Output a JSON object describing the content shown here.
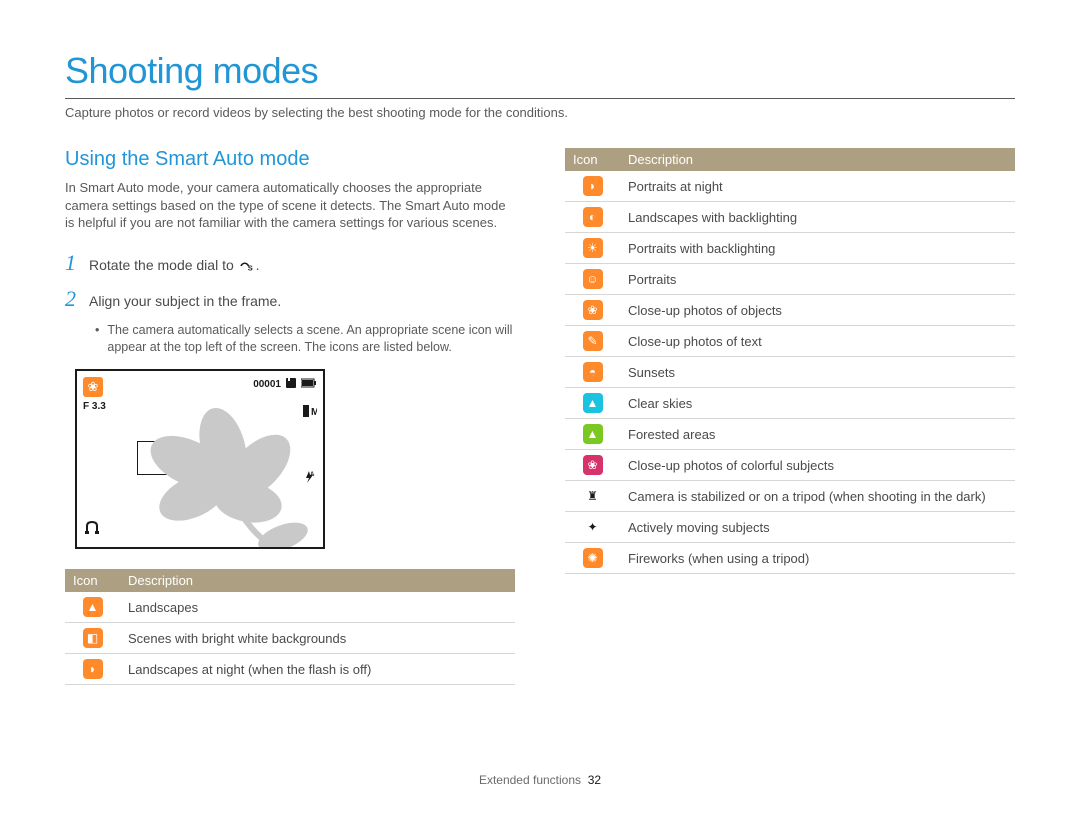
{
  "title": "Shooting modes",
  "subtitle": "Capture photos or record videos by selecting the best shooting mode for the conditions.",
  "section_heading": "Using the Smart Auto mode",
  "section_body": "In Smart Auto mode, your camera automatically chooses the appropriate camera settings based on the type of scene it detects. The Smart Auto mode is helpful if you are not familiar with the camera settings for various scenes.",
  "steps": {
    "s1_num": "1",
    "s1_text": "Rotate the mode dial to ",
    "s1_icon_label": "smart-auto-glyph",
    "s1_tail": ".",
    "s2_num": "2",
    "s2_text": "Align your subject in the frame.",
    "s2_sub": "The camera automatically selects a scene. An appropriate scene icon will appear at the top left of the screen. The icons are listed below."
  },
  "screen": {
    "fnum": "F 3.3",
    "counter": "00001",
    "mem_icon": "memory-card-icon",
    "batt_icon": "battery-icon",
    "quality": "M",
    "flash": "flash-auto-icon",
    "ois": "ois-icon",
    "topleft_icon": "macro-flower-icon"
  },
  "table_headers": {
    "icon": "Icon",
    "desc": "Description"
  },
  "left_table": [
    {
      "icon": "landscape-icon",
      "color": "orange",
      "glyph": "▲",
      "desc": "Landscapes"
    },
    {
      "icon": "white-bg-icon",
      "color": "orange",
      "glyph": "◧",
      "desc": "Scenes with bright white backgrounds"
    },
    {
      "icon": "night-landscape-icon",
      "color": "orange",
      "glyph": "◗",
      "desc": "Landscapes at night (when the flash is off)"
    }
  ],
  "right_table": [
    {
      "icon": "night-portrait-icon",
      "color": "orange",
      "glyph": "◗",
      "desc": "Portraits at night"
    },
    {
      "icon": "backlit-landscape-icon",
      "color": "orange",
      "glyph": "◐",
      "desc": "Landscapes with backlighting"
    },
    {
      "icon": "backlit-portrait-icon",
      "color": "orange",
      "glyph": "☀",
      "desc": "Portraits with backlighting"
    },
    {
      "icon": "portrait-icon",
      "color": "orange",
      "glyph": "☺",
      "desc": "Portraits"
    },
    {
      "icon": "macro-object-icon",
      "color": "orange",
      "glyph": "❀",
      "desc": "Close-up photos of objects"
    },
    {
      "icon": "macro-text-icon",
      "color": "orange",
      "glyph": "✎",
      "desc": "Close-up photos of text"
    },
    {
      "icon": "sunset-icon",
      "color": "orange",
      "glyph": "◓",
      "desc": "Sunsets"
    },
    {
      "icon": "clear-sky-icon",
      "color": "cyan",
      "glyph": "▲",
      "desc": "Clear skies"
    },
    {
      "icon": "forest-icon",
      "color": "green",
      "glyph": "▲",
      "desc": "Forested areas"
    },
    {
      "icon": "macro-color-icon",
      "color": "magenta",
      "glyph": "❀",
      "desc": "Close-up photos of colorful subjects"
    },
    {
      "icon": "tripod-icon",
      "color": "black-ic",
      "glyph": "♜",
      "desc": "Camera is stabilized or on a tripod (when shooting in the dark)"
    },
    {
      "icon": "action-icon",
      "color": "black-ic",
      "glyph": "✦",
      "desc": "Actively moving subjects"
    },
    {
      "icon": "fireworks-icon",
      "color": "orange",
      "glyph": "✺",
      "desc": "Fireworks (when using a tripod)"
    }
  ],
  "footer": {
    "section": "Extended functions",
    "page": "32"
  }
}
